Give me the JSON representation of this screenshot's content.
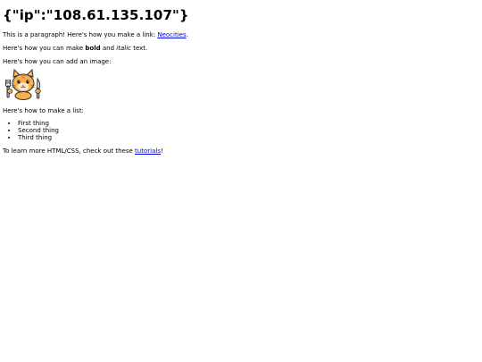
{
  "heading": "{\"ip\":\"108.61.135.107\"}",
  "intro": {
    "prefix": "This is a paragraph! Here's how you make a link: ",
    "link_text": "Neocities",
    "suffix": "."
  },
  "format": {
    "prefix": "Here's how you can make ",
    "bold": "bold",
    "middle": " and ",
    "italic": "italic",
    "suffix": " text."
  },
  "image_intro": "Here's how you can add an image:",
  "image_icon": "neocities-cat-mascot",
  "list_intro": "Here's how to make a list:",
  "list_items": [
    "First thing",
    "Second thing",
    "Third thing"
  ],
  "outro": {
    "prefix": "To learn more HTML/CSS, check out these ",
    "link_text": "tutorials",
    "suffix": "!"
  }
}
